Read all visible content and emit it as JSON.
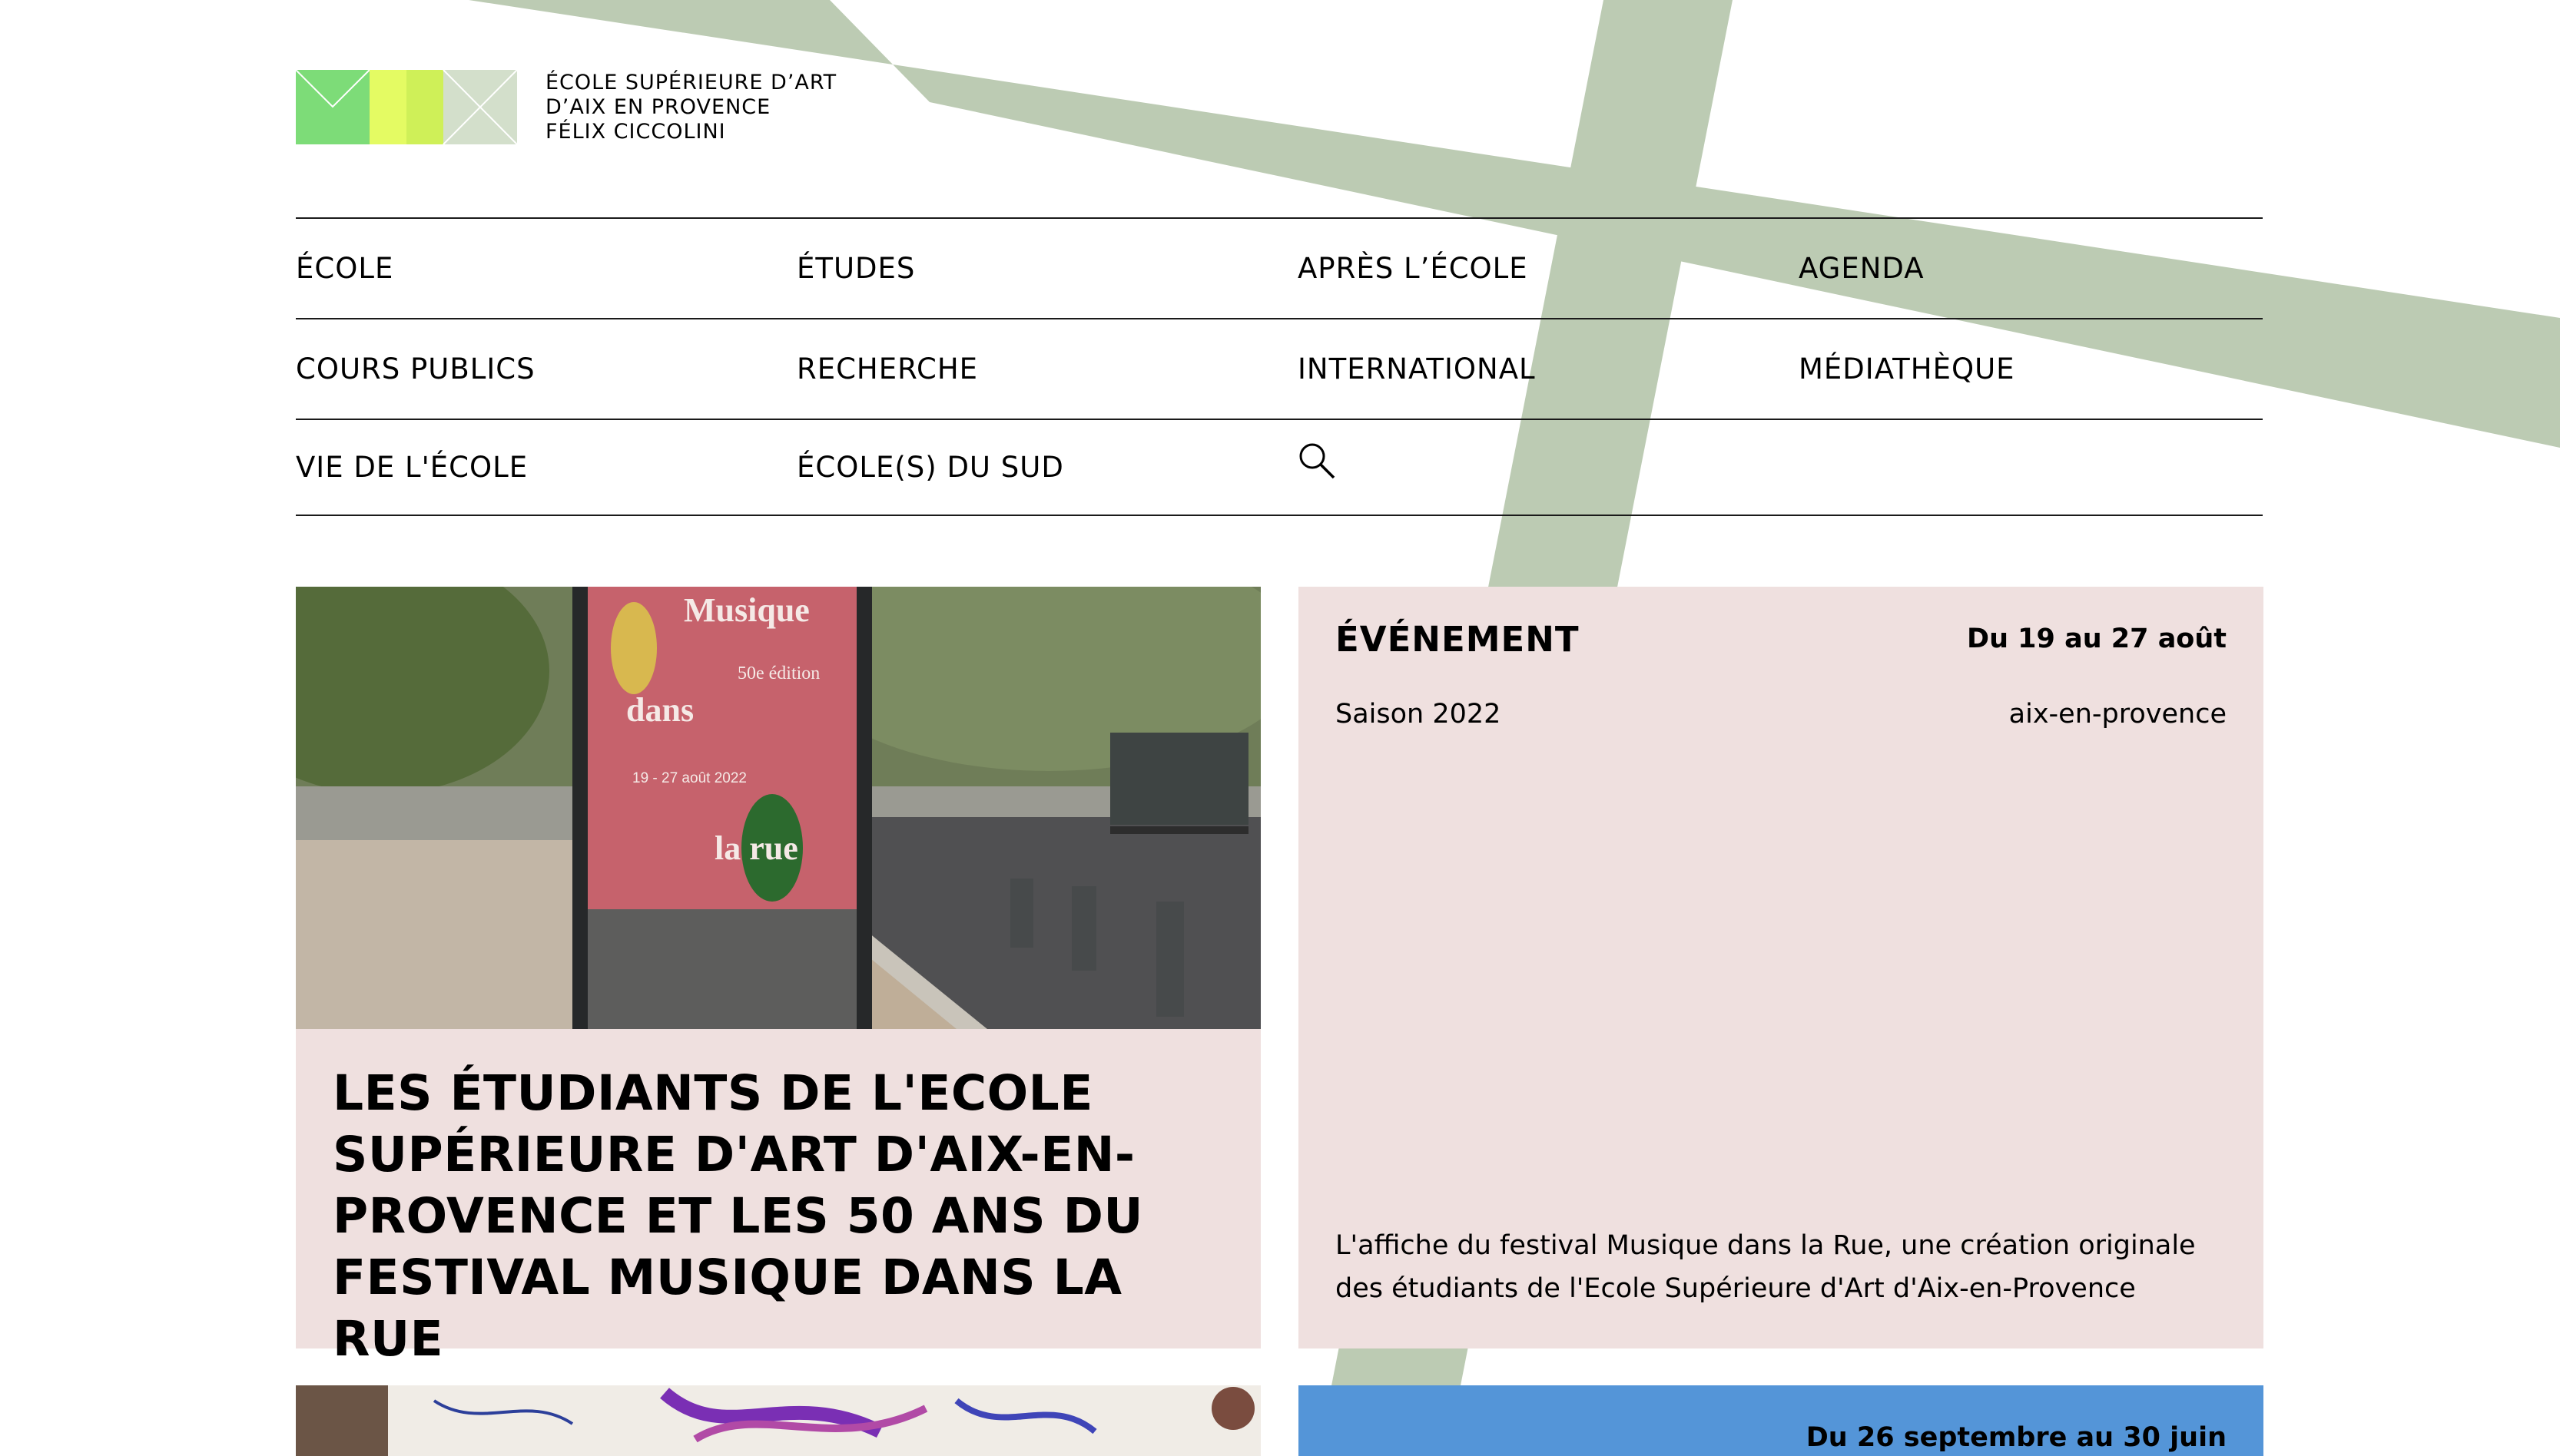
{
  "header": {
    "school_name": [
      "ÉCOLE SUPÉRIEURE D’ART",
      "D’AIX EN PROVENCE",
      "FÉLIX CICCOLINI"
    ]
  },
  "nav": {
    "items": [
      "ÉCOLE",
      "ÉTUDES",
      "APRÈS L’ÉCOLE",
      "AGENDA",
      "COURS PUBLICS",
      "RECHERCHE",
      "INTERNATIONAL",
      "MÉDIATHÈQUE",
      "VIE DE L'ÉCOLE",
      "ÉCOLE(S) DU SUD"
    ],
    "search_icon": "search-icon"
  },
  "feature": {
    "poster_title_top": "Musique",
    "poster_title_mid": "dans",
    "poster_title_bottom": "la rue",
    "poster_edition": "50e édition",
    "poster_dates": "19 - 27 août 2022",
    "headline": "LES ÉTUDIANTS DE L'ECOLE SUPÉRIEURE D'ART D'AIX-EN-PROVENCE ET LES 50 ANS DU FESTIVAL MUSIQUE DANS LA RUE"
  },
  "event": {
    "category": "ÉVÉNEMENT",
    "date": "Du 19 au 27 août",
    "season": "Saison 2022",
    "location": "aix-en-provence",
    "description": "L'affiche du festival Musique dans la Rue, une création originale des étudiants de l'Ecole Supérieure d'Art d'Aix-en-Provence"
  },
  "next_event": {
    "date": "Du 26 septembre au 30 juin"
  },
  "colors": {
    "cross_green": "#bccbb3",
    "card_pink": "#efe0df",
    "card_blue": "#5495d8",
    "logo_green": "#7ddc78",
    "logo_lime": "#d4f55a"
  }
}
